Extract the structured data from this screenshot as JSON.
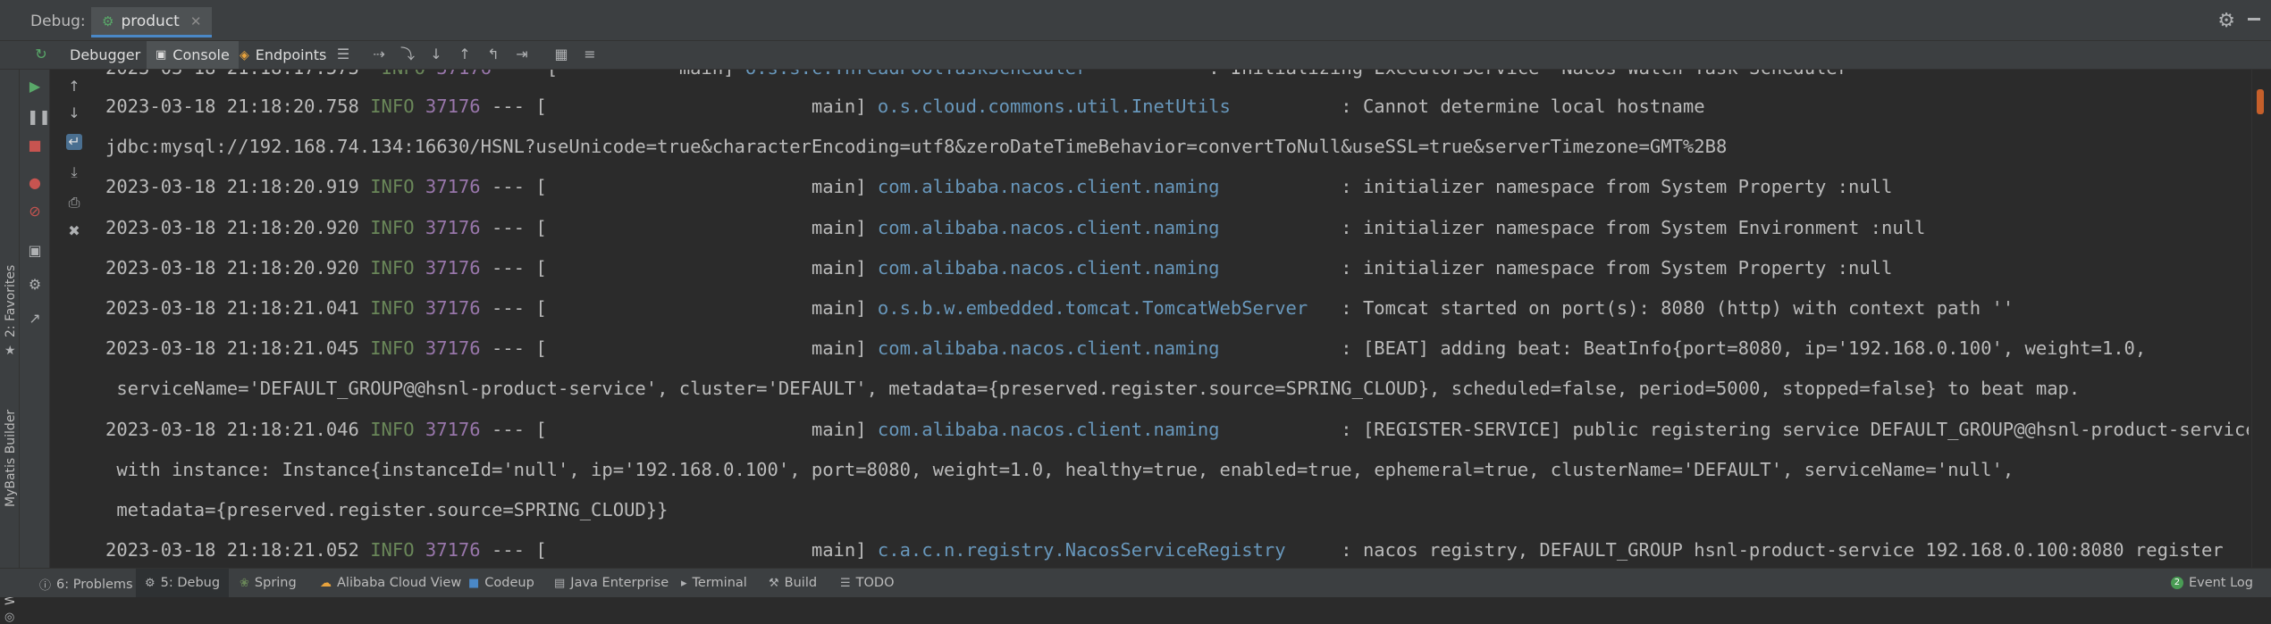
{
  "window": {
    "label": "Debug:",
    "tab_label": "product"
  },
  "toolbar": {
    "tabs": [
      {
        "label": "Debugger"
      },
      {
        "label": "Console"
      },
      {
        "label": "Endpoints"
      }
    ]
  },
  "side_tools": {
    "favorites": "2: Favorites",
    "mybatis": "MyBatis Builder",
    "web": "Web"
  },
  "console": {
    "lines": [
      {
        "ts": "2023-03-18 21:18:20.758",
        "level": "INFO",
        "pid": "37176",
        "sep": "--- [",
        "thread": "main]",
        "logger": "o.s.cloud.commons.util.InetUtils",
        "msg": ": Cannot determine local hostname"
      },
      {
        "raw": "jdbc:mysql://192.168.74.134:16630/HSNL?useUnicode=true&characterEncoding=utf8&zeroDateTimeBehavior=convertToNull&useSSL=true&serverTimezone=GMT%2B8"
      },
      {
        "ts": "2023-03-18 21:18:20.919",
        "level": "INFO",
        "pid": "37176",
        "sep": "--- [",
        "thread": "main]",
        "logger": "com.alibaba.nacos.client.naming",
        "msg": ": initializer namespace from System Property :null"
      },
      {
        "ts": "2023-03-18 21:18:20.920",
        "level": "INFO",
        "pid": "37176",
        "sep": "--- [",
        "thread": "main]",
        "logger": "com.alibaba.nacos.client.naming",
        "msg": ": initializer namespace from System Environment :null"
      },
      {
        "ts": "2023-03-18 21:18:20.920",
        "level": "INFO",
        "pid": "37176",
        "sep": "--- [",
        "thread": "main]",
        "logger": "com.alibaba.nacos.client.naming",
        "msg": ": initializer namespace from System Property :null"
      },
      {
        "ts": "2023-03-18 21:18:21.041",
        "level": "INFO",
        "pid": "37176",
        "sep": "--- [",
        "thread": "main]",
        "logger": "o.s.b.w.embedded.tomcat.TomcatWebServer",
        "msg": ": Tomcat started on port(s): 8080 (http) with context path ''"
      },
      {
        "ts": "2023-03-18 21:18:21.045",
        "level": "INFO",
        "pid": "37176",
        "sep": "--- [",
        "thread": "main]",
        "logger": "com.alibaba.nacos.client.naming",
        "msg": ": [BEAT] adding beat: BeatInfo{port=8080, ip='192.168.0.100', weight=1.0,"
      },
      {
        "raw": " serviceName='DEFAULT_GROUP@@hsnl-product-service', cluster='DEFAULT', metadata={preserved.register.source=SPRING_CLOUD}, scheduled=false, period=5000, stopped=false} to beat map."
      },
      {
        "ts": "2023-03-18 21:18:21.046",
        "level": "INFO",
        "pid": "37176",
        "sep": "--- [",
        "thread": "main]",
        "logger": "com.alibaba.nacos.client.naming",
        "msg": ": [REGISTER-SERVICE] public registering service DEFAULT_GROUP@@hsnl-product-service"
      },
      {
        "raw": " with instance: Instance{instanceId='null', ip='192.168.0.100', port=8080, weight=1.0, healthy=true, enabled=true, ephemeral=true, clusterName='DEFAULT', serviceName='null',"
      },
      {
        "raw": " metadata={preserved.register.source=SPRING_CLOUD}}"
      },
      {
        "ts": "2023-03-18 21:18:21.052",
        "level": "INFO",
        "pid": "37176",
        "sep": "--- [",
        "thread": "main]",
        "logger": "c.a.c.n.registry.NacosServiceRegistry",
        "msg": ": nacos registry, DEFAULT_GROUP hsnl-product-service 192.168.0.100:8080 register"
      }
    ]
  },
  "statusbar": {
    "items": [
      {
        "label": "6: Problems",
        "icon": "warning-icon"
      },
      {
        "label": "5: Debug",
        "icon": "bug-icon"
      },
      {
        "label": "Spring",
        "icon": "spring-icon"
      },
      {
        "label": "Alibaba Cloud View",
        "icon": "cloud-icon"
      },
      {
        "label": "Codeup",
        "icon": "codeup-icon"
      },
      {
        "label": "Java Enterprise",
        "icon": "java-enterprise-icon"
      },
      {
        "label": "Terminal",
        "icon": "terminal-icon"
      },
      {
        "label": "Build",
        "icon": "hammer-icon"
      },
      {
        "label": "TODO",
        "icon": "list-icon"
      }
    ],
    "event_log": "Event Log",
    "event_count": "2"
  },
  "colors": {
    "info": "#6a8759",
    "pid": "#9876aa",
    "logger": "#6897bb",
    "accent": "#4a88c7"
  }
}
